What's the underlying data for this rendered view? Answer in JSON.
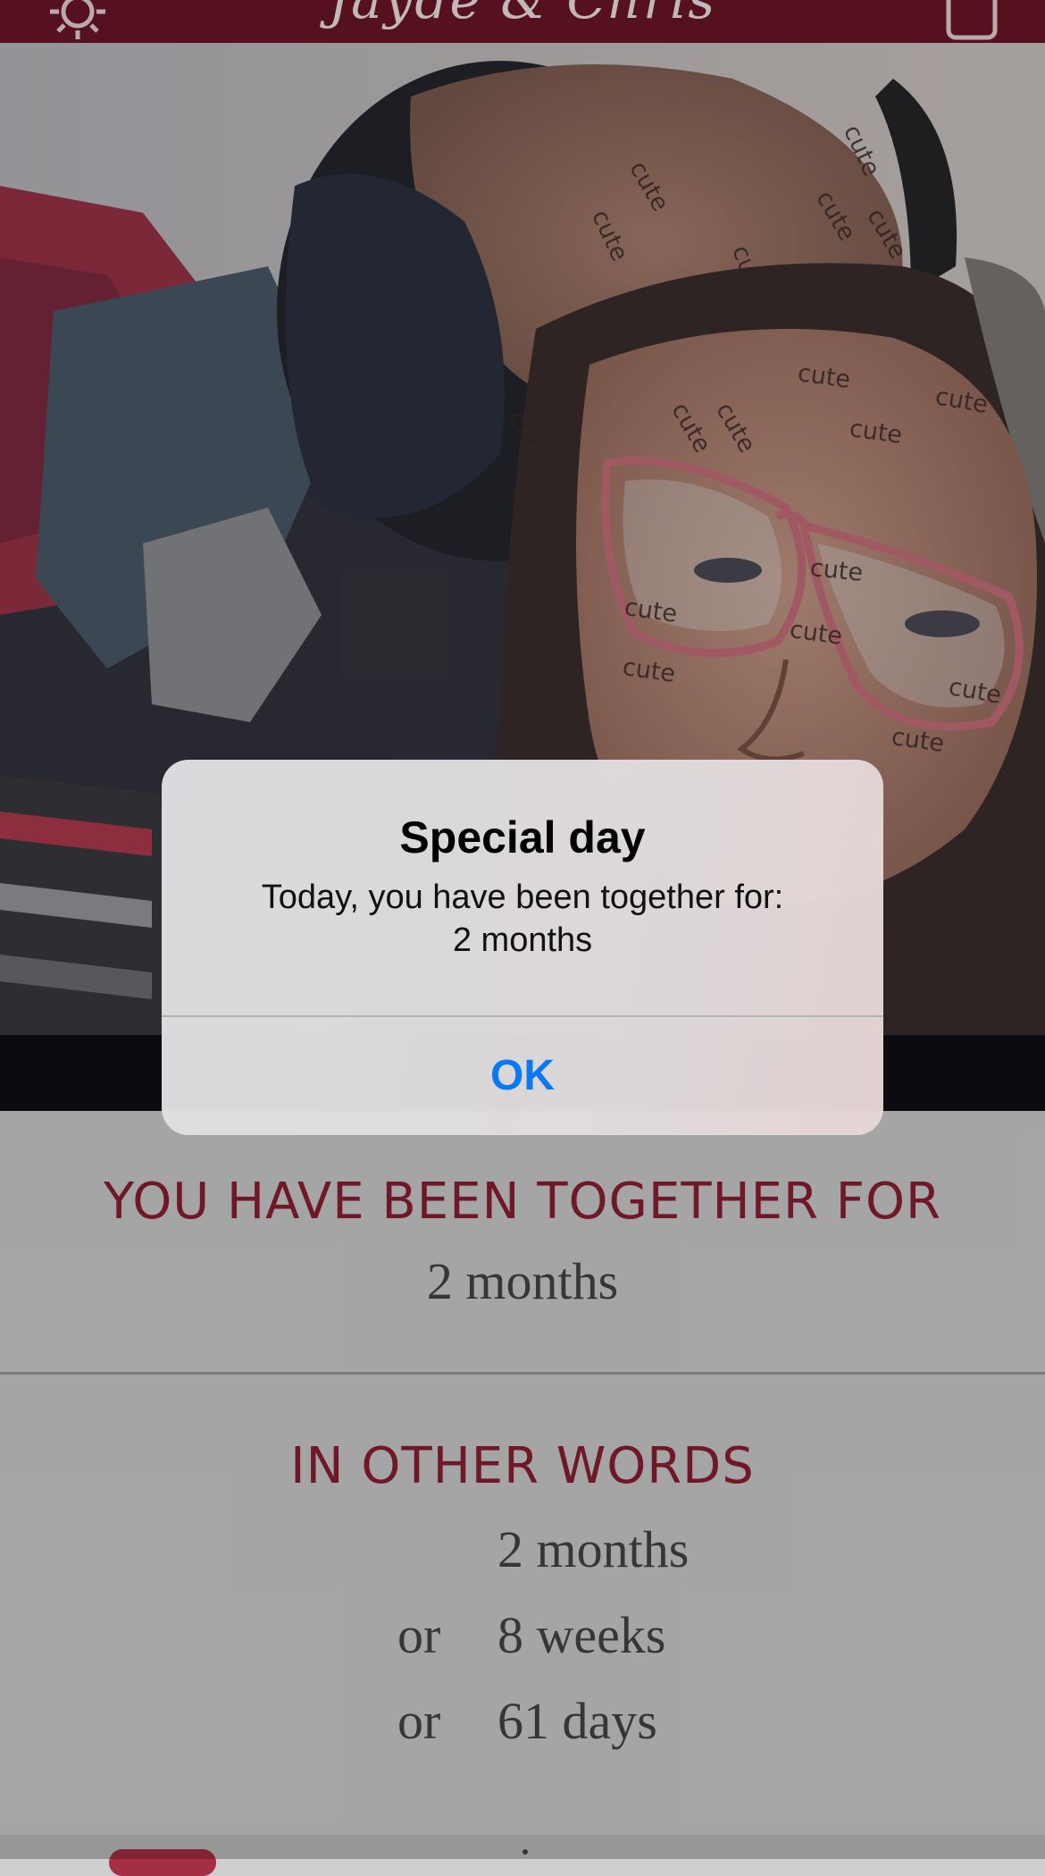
{
  "header": {
    "title": "Jayde & Chris",
    "settings_icon": "gear-icon",
    "share_icon": "share-icon"
  },
  "photo": {
    "stickers": [
      "cute",
      "cute",
      "cute",
      "cute",
      "cute",
      "cute",
      "cute",
      "cute",
      "cute",
      "cute",
      "cute",
      "cute",
      "cute",
      "cute",
      "cute",
      "cute",
      "cute",
      "cute",
      "cute",
      "cute",
      "cute",
      "cute",
      "cute",
      "cute"
    ]
  },
  "together": {
    "heading": "YOU HAVE BEEN TOGETHER FOR",
    "value": "2 months"
  },
  "other_words": {
    "heading": "IN OTHER WORDS",
    "rows": [
      {
        "prefix": "",
        "value": "2 months"
      },
      {
        "prefix": "or",
        "value": "8 weeks"
      },
      {
        "prefix": "or",
        "value": "61 days"
      }
    ]
  },
  "alert": {
    "title": "Special day",
    "message_line1": "Today, you have been together for:",
    "message_line2": "2 months",
    "ok_label": "OK"
  },
  "colors": {
    "header_bg": "#6b1726",
    "accent_red": "#8a1f33",
    "ios_blue": "#0a79f2"
  }
}
